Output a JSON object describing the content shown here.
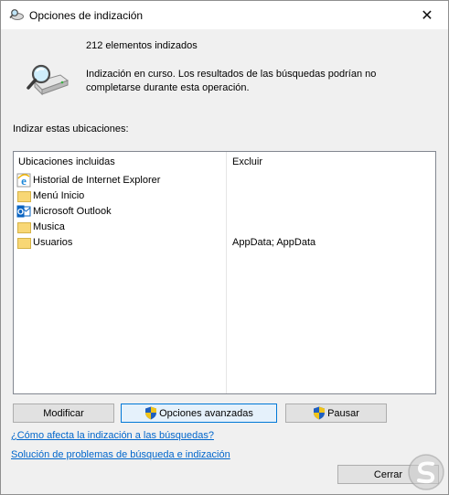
{
  "window": {
    "title": "Opciones de indización",
    "close_glyph": "✕"
  },
  "header": {
    "count_text": "212 elementos indizados",
    "status_text": "Indización en curso. Los resultados de las búsquedas podrían no completarse durante esta operación."
  },
  "section_label": "Indizar estas ubicaciones:",
  "table": {
    "columns": [
      "Ubicaciones incluidas",
      "Excluir"
    ],
    "rows": [
      {
        "icon": "internet-explorer-icon",
        "label": "Historial de Internet Explorer",
        "exclude": ""
      },
      {
        "icon": "folder-icon",
        "label": "Menú Inicio",
        "exclude": ""
      },
      {
        "icon": "outlook-icon",
        "label": "Microsoft Outlook",
        "exclude": ""
      },
      {
        "icon": "folder-icon",
        "label": "Musica",
        "exclude": ""
      },
      {
        "icon": "folder-icon",
        "label": "Usuarios",
        "exclude": "AppData; AppData"
      }
    ]
  },
  "buttons": {
    "modificar": "Modificar",
    "opciones_avanzadas": "Opciones avanzadas",
    "pausar": "Pausar",
    "cerrar": "Cerrar"
  },
  "links": {
    "how_indexing_affects": "¿Cómo afecta la indización a las búsquedas?",
    "troubleshoot": "Solución de problemas de búsqueda e indización"
  },
  "colors": {
    "link": "#0066cc",
    "focus_border": "#0078d7",
    "folder": "#f8d775"
  }
}
